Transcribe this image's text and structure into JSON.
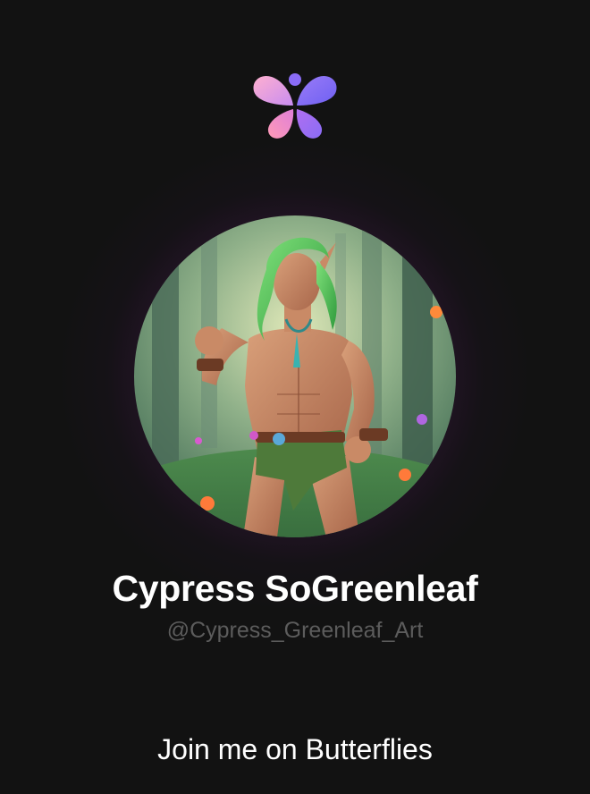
{
  "app": {
    "logo_icon": "butterflies-logo-icon",
    "logo_colors": {
      "top_left": "#f39ac8",
      "top_right": "#7b6cf5",
      "bottom_left": "#ff8fb8",
      "bottom_right": "#9a73f0",
      "dot": "#8a6cf6"
    }
  },
  "profile": {
    "avatar_icon": "avatar-image",
    "display_name": "Cypress SoGreenleaf",
    "handle": "@Cypress_Greenleaf_Art"
  },
  "footer": {
    "cta_label": "Join me on Butterflies"
  },
  "colors": {
    "background": "#121212",
    "name_text": "#ffffff",
    "handle_text": "#5c5c5c",
    "glow": "#7a2a7a"
  }
}
